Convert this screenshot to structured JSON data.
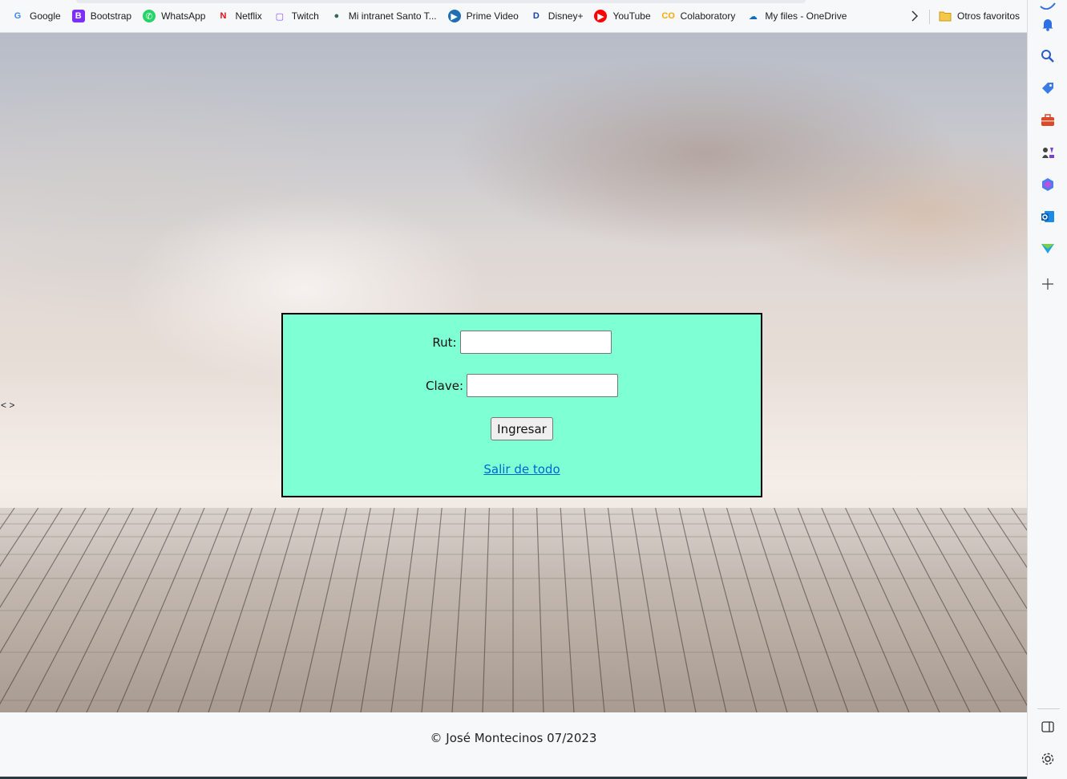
{
  "bookmarks": {
    "items": [
      {
        "label": "Google",
        "icon": "google-icon",
        "icon_text": "G",
        "color": "#4285f4",
        "bg": "transparent"
      },
      {
        "label": "Bootstrap",
        "icon": "bootstrap-icon",
        "icon_text": "B",
        "color": "#ffffff",
        "bg": "#7b2ff7"
      },
      {
        "label": "WhatsApp",
        "icon": "whatsapp-icon",
        "icon_text": "✆",
        "color": "#ffffff",
        "bg": "#25d366"
      },
      {
        "label": "Netflix",
        "icon": "netflix-icon",
        "icon_text": "N",
        "color": "#e50914",
        "bg": "transparent"
      },
      {
        "label": "Twitch",
        "icon": "twitch-icon",
        "icon_text": "▢",
        "color": "#9146ff",
        "bg": "transparent"
      },
      {
        "label": "Mi intranet Santo T...",
        "icon": "intranet-globe-icon",
        "icon_text": "●",
        "color": "#2e6b4f",
        "bg": "transparent"
      },
      {
        "label": "Prime Video",
        "icon": "prime-video-icon",
        "icon_text": "▶",
        "color": "#ffffff",
        "bg": "#1f6fb2"
      },
      {
        "label": "Disney+",
        "icon": "disney-plus-icon",
        "icon_text": "D",
        "color": "#1a3fb0",
        "bg": "transparent"
      },
      {
        "label": "YouTube",
        "icon": "youtube-icon",
        "icon_text": "▶",
        "color": "#ffffff",
        "bg": "#ff0000"
      },
      {
        "label": "Colaboratory",
        "icon": "colab-icon",
        "icon_text": "CO",
        "color": "#f9ab00",
        "bg": "transparent"
      },
      {
        "label": "My files - OneDrive",
        "icon": "onedrive-icon",
        "icon_text": "☁",
        "color": "#0f6cbd",
        "bg": "transparent"
      }
    ],
    "more_icon": "chevron-right-icon",
    "others_label": "Otros favoritos",
    "others_icon": "folder-icon"
  },
  "sidebar": {
    "icons": [
      "bell-icon",
      "search-icon",
      "tag-icon",
      "briefcase-icon",
      "chess-icon",
      "copilot-icon",
      "outlook-icon",
      "send-icon",
      "add-icon"
    ],
    "bottom_icons": [
      "split-screen-icon",
      "settings-icon"
    ]
  },
  "page": {
    "side_arrows": "< >",
    "form": {
      "rut_label": "Rut:",
      "clave_label": "Clave:",
      "submit_label": "Ingresar",
      "logout_link": "Salir de todo",
      "rut_value": "",
      "clave_value": ""
    },
    "footer": "© José Montecinos 07/2023"
  },
  "colors": {
    "panel_bg": "#7fffd4",
    "link": "#0066cc"
  }
}
